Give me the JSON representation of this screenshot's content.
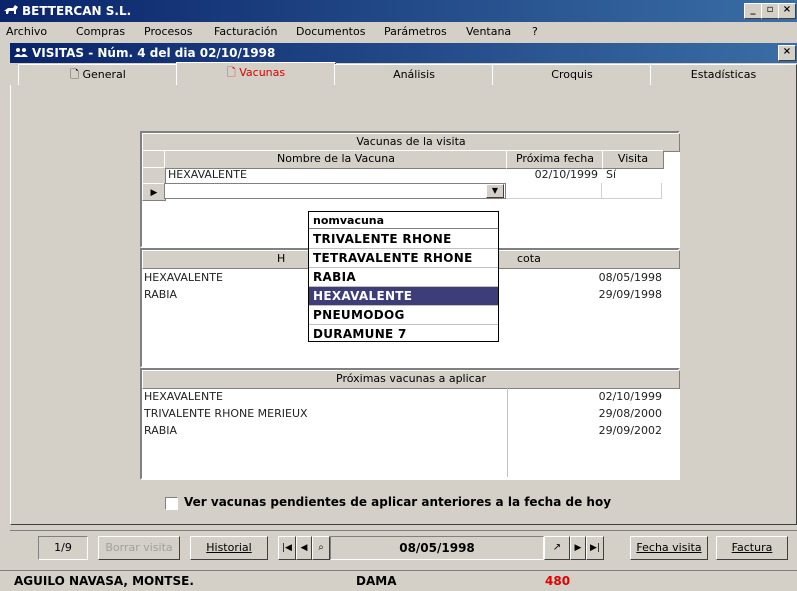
{
  "app": {
    "title": "BETTERCAN S.L.",
    "min": "_",
    "max": "▫",
    "close": "×"
  },
  "menu": [
    "Archivo",
    "Compras",
    "Procesos",
    "Facturación",
    "Documentos",
    "Parámetros",
    "Ventana",
    "?"
  ],
  "window": {
    "title": "VISITAS - Núm. 4 del dia 02/10/1998",
    "close": "×"
  },
  "tabs": [
    "General",
    "Vacunas",
    "Análisis",
    "Croquis",
    "Estadísticas"
  ],
  "visit_vaccines": {
    "title": "Vacunas de la visita",
    "col_name": "Nombre de la Vacuna",
    "col_next": "Próxima fecha",
    "col_visit": "Visita",
    "rows": [
      {
        "name": "HEXAVALENTE",
        "next": "02/10/1999",
        "visit": "Sí"
      }
    ]
  },
  "dropdown": {
    "header": "nomvacuna",
    "items": [
      "TRIVALENTE RHONE",
      "TETRAVALENTE RHONE",
      "RABIA",
      "HEXAVALENTE",
      "PNEUMODOG",
      "DURAMUNE 7"
    ],
    "selected": "HEXAVALENTE"
  },
  "history": {
    "title_left": "H",
    "title_right": "cota",
    "rows": [
      {
        "name": "HEXAVALENTE",
        "date": "08/05/1998"
      },
      {
        "name": "RABIA",
        "date": "29/09/1998"
      }
    ]
  },
  "upcoming": {
    "title": "Próximas vacunas a aplicar",
    "rows": [
      {
        "name": "HEXAVALENTE",
        "date": "02/10/1999"
      },
      {
        "name": "TRIVALENTE RHONE MERIEUX",
        "date": "29/08/2000"
      },
      {
        "name": "RABIA",
        "date": "29/09/2002"
      }
    ]
  },
  "pending_checkbox": {
    "label": "Ver vacunas pendientes de aplicar anteriores a la fecha de hoy",
    "checked": false
  },
  "footer": {
    "record": "1/9",
    "delete": "Borrar visita",
    "history": "Historial",
    "date": "08/05/1998",
    "visit_date": "Fecha visita",
    "invoice": "Factura"
  },
  "status": {
    "owner": "AGUILO NAVASA, MONTSE.",
    "pet": "DAMA",
    "code": "480"
  }
}
